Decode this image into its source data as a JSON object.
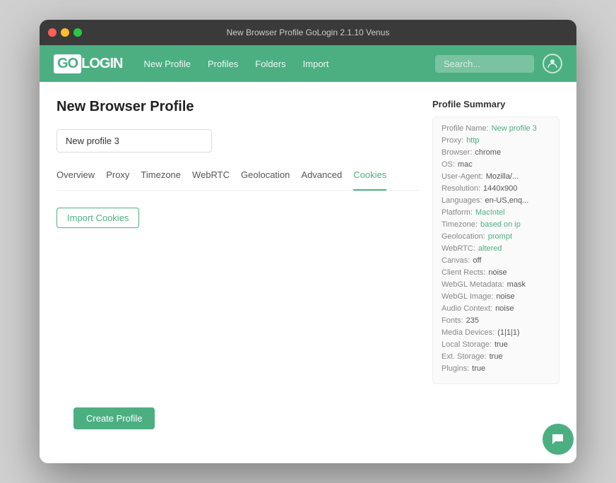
{
  "titlebar": {
    "title": "New Browser Profile GoLogin 2.1.10 Venus"
  },
  "navbar": {
    "logo_go": "GO",
    "logo_login": "LOGIN",
    "links": [
      {
        "label": "New Profile",
        "name": "new-profile-link"
      },
      {
        "label": "Profiles",
        "name": "profiles-link"
      },
      {
        "label": "Folders",
        "name": "folders-link"
      },
      {
        "label": "Import",
        "name": "import-link"
      }
    ],
    "search_placeholder": "Search..."
  },
  "main": {
    "page_title": "New Browser Profile",
    "profile_name_value": "New profile 3",
    "tabs": [
      {
        "label": "Overview",
        "name": "tab-overview",
        "active": false
      },
      {
        "label": "Proxy",
        "name": "tab-proxy",
        "active": false
      },
      {
        "label": "Timezone",
        "name": "tab-timezone",
        "active": false
      },
      {
        "label": "WebRTC",
        "name": "tab-webrtc",
        "active": false
      },
      {
        "label": "Geolocation",
        "name": "tab-geolocation",
        "active": false
      },
      {
        "label": "Advanced",
        "name": "tab-advanced",
        "active": false
      },
      {
        "label": "Cookies",
        "name": "tab-cookies",
        "active": true
      }
    ],
    "import_cookies_label": "Import Cookies",
    "create_profile_label": "Create Profile"
  },
  "summary": {
    "title": "Profile Summary",
    "rows": [
      {
        "label": "Profile Name:",
        "value": "New profile 3",
        "colored": true
      },
      {
        "label": "Proxy:",
        "value": "http",
        "colored": true
      },
      {
        "label": "Browser:",
        "value": "chrome",
        "colored": false
      },
      {
        "label": "OS:",
        "value": "mac",
        "colored": false
      },
      {
        "label": "User-Agent:",
        "value": "Mozilla/...",
        "colored": false
      },
      {
        "label": "Resolution:",
        "value": "1440x900",
        "colored": false
      },
      {
        "label": "Languages:",
        "value": "en-US,enq...",
        "colored": false
      },
      {
        "label": "Platform:",
        "value": "MacIntel",
        "colored": true
      },
      {
        "label": "Timezone:",
        "value": "based on ip",
        "colored": true
      },
      {
        "label": "Geolocation:",
        "value": "prompt",
        "colored": true
      },
      {
        "label": "WebRTC:",
        "value": "altered",
        "colored": true
      },
      {
        "label": "Canvas:",
        "value": "off",
        "colored": false
      },
      {
        "label": "Client Rects:",
        "value": "noise",
        "colored": false
      },
      {
        "label": "WebGL Metadata:",
        "value": "mask",
        "colored": false
      },
      {
        "label": "WebGL Image:",
        "value": "noise",
        "colored": false
      },
      {
        "label": "Audio Context:",
        "value": "noise",
        "colored": false
      },
      {
        "label": "Fonts:",
        "value": "235",
        "colored": false
      },
      {
        "label": "Media Devices:",
        "value": "(1|1|1)",
        "colored": false
      },
      {
        "label": "Local Storage:",
        "value": "true",
        "colored": false
      },
      {
        "label": "Ext. Storage:",
        "value": "true",
        "colored": false
      },
      {
        "label": "Plugins:",
        "value": "true",
        "colored": false
      }
    ]
  }
}
